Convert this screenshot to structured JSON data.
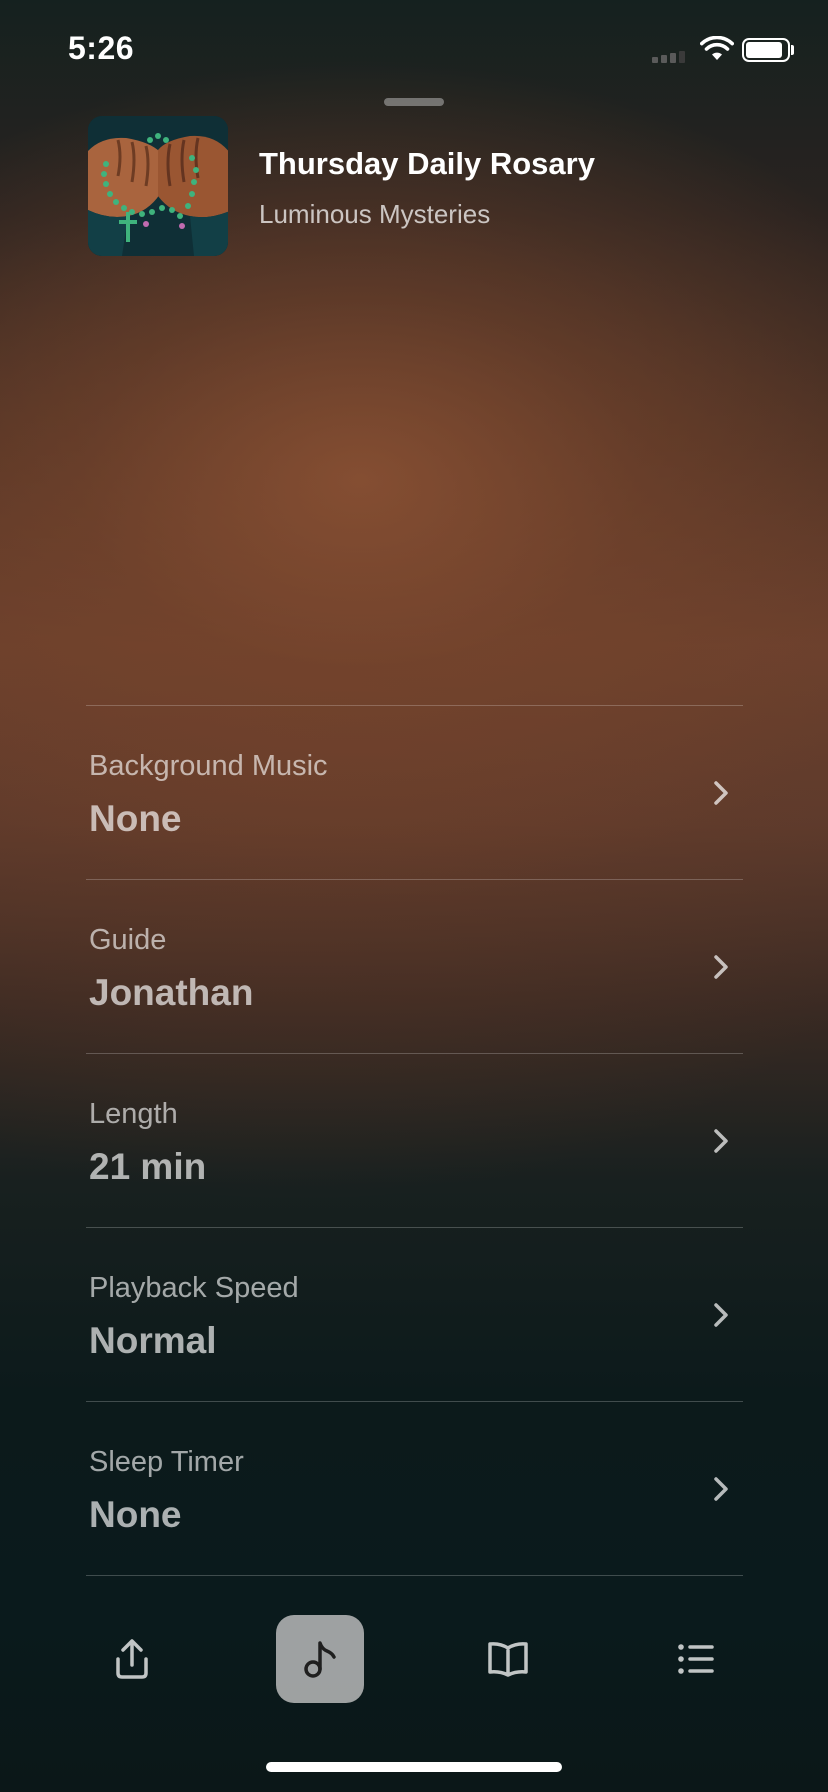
{
  "status_bar": {
    "time": "5:26",
    "battery_level": 0.9
  },
  "now_playing": {
    "title": "Thursday Daily Rosary",
    "subtitle": "Luminous Mysteries",
    "artwork_icon": "rosary-hands-artwork"
  },
  "settings": [
    {
      "label": "Background Music",
      "value": "None"
    },
    {
      "label": "Guide",
      "value": "Jonathan"
    },
    {
      "label": "Length",
      "value": "21 min"
    },
    {
      "label": "Playback Speed",
      "value": "Normal"
    },
    {
      "label": "Sleep Timer",
      "value": "None"
    }
  ],
  "toolbar": {
    "items": [
      {
        "icon": "share-icon",
        "active": false
      },
      {
        "icon": "music-note-icon",
        "active": true
      },
      {
        "icon": "book-icon",
        "active": false
      },
      {
        "icon": "list-icon",
        "active": false
      }
    ]
  },
  "colors": {
    "background_top": "#15211f",
    "background_mid": "#6a402e",
    "background_bottom": "#0b1718",
    "active_tab": "#c8c8c8"
  }
}
